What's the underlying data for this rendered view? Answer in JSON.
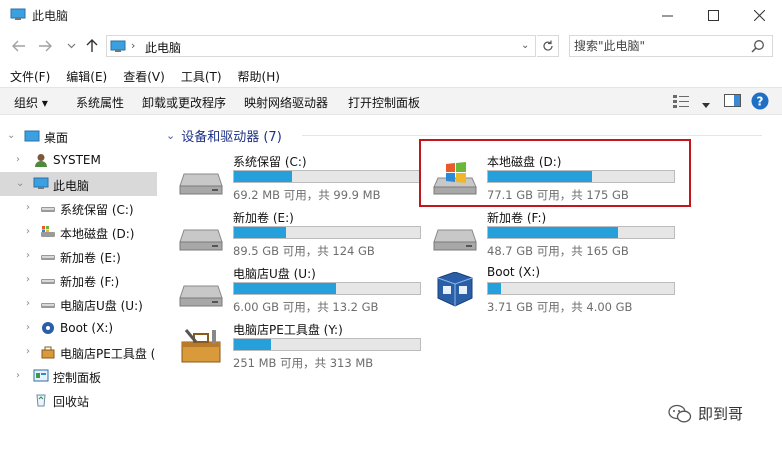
{
  "window": {
    "title": "此电脑"
  },
  "address": {
    "path": "此电脑",
    "search_placeholder": "搜索\"此电脑\""
  },
  "menu": [
    "文件(F)",
    "编辑(E)",
    "查看(V)",
    "工具(T)",
    "帮助(H)"
  ],
  "commands": [
    "组织 ▾",
    "系统属性",
    "卸载或更改程序",
    "映射网络驱动器",
    "打开控制面板"
  ],
  "nav": [
    {
      "label": "桌面",
      "icon": "desktop-icon"
    },
    {
      "label": "SYSTEM",
      "icon": "user-icon"
    },
    {
      "label": "此电脑",
      "icon": "computer-icon"
    },
    {
      "label": "系统保留 (C:)",
      "icon": "drive-icon"
    },
    {
      "label": "本地磁盘 (D:)",
      "icon": "windows-drive-icon"
    },
    {
      "label": "新加卷 (E:)",
      "icon": "drive-icon"
    },
    {
      "label": "新加卷 (F:)",
      "icon": "drive-icon"
    },
    {
      "label": "电脑店U盘 (U:)",
      "icon": "drive-icon"
    },
    {
      "label": "Boot (X:)",
      "icon": "boot-drive-icon"
    },
    {
      "label": "电脑店PE工具盘 (",
      "icon": "toolbox-icon"
    },
    {
      "label": "控制面板",
      "icon": "control-panel-icon"
    },
    {
      "label": "回收站",
      "icon": "recycle-bin-icon"
    }
  ],
  "group": {
    "title": "设备和驱动器 (7)"
  },
  "drives": [
    {
      "name": "系统保留 (C:)",
      "info": "69.2 MB 可用，共 99.9 MB",
      "used_fraction": 0.31,
      "icon": "drive-icon"
    },
    {
      "name": "本地磁盘 (D:)",
      "info": "77.1 GB 可用，共 175 GB",
      "used_fraction": 0.56,
      "icon": "windows-drive-icon"
    },
    {
      "name": "新加卷 (E:)",
      "info": "89.5 GB 可用，共 124 GB",
      "used_fraction": 0.28,
      "icon": "drive-icon"
    },
    {
      "name": "新加卷 (F:)",
      "info": "48.7 GB 可用，共 165 GB",
      "used_fraction": 0.7,
      "icon": "drive-icon"
    },
    {
      "name": "电脑店U盘 (U:)",
      "info": "6.00 GB 可用，共 13.2 GB",
      "used_fraction": 0.55,
      "icon": "drive-icon"
    },
    {
      "name": "Boot (X:)",
      "info": "3.71 GB 可用，共 4.00 GB",
      "used_fraction": 0.07,
      "icon": "boot-drive-icon"
    },
    {
      "name": "电脑店PE工具盘 (Y:)",
      "info": "251 MB 可用，共 313 MB",
      "used_fraction": 0.2,
      "icon": "toolbox-icon"
    }
  ],
  "watermark": {
    "text": "即到哥"
  },
  "colors": {
    "progress": "#26a0da",
    "selected_nav": "#d9d9d9",
    "highlight_box": "#c0161c",
    "group_title": "#1e3287"
  }
}
